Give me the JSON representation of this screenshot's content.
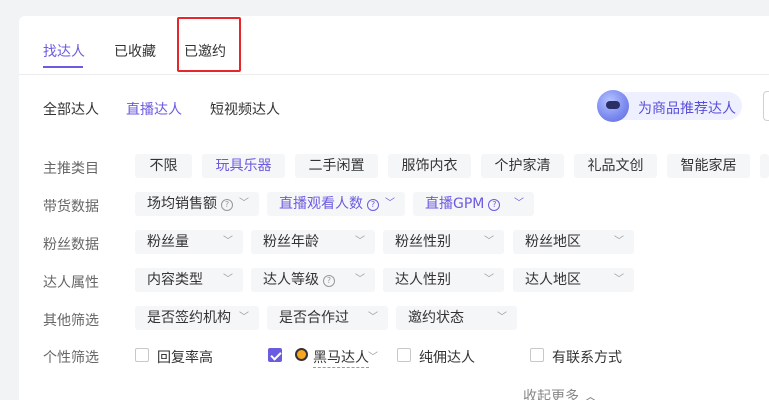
{
  "tabs": [
    {
      "label": "找达人",
      "active": true
    },
    {
      "label": "已收藏",
      "active": false
    },
    {
      "label": "已邀约",
      "active": false
    }
  ],
  "subtabs": [
    {
      "label": "全部达人",
      "active": false
    },
    {
      "label": "直播达人",
      "active": true
    },
    {
      "label": "短视频达人",
      "active": false
    }
  ],
  "recommend_button": {
    "label": "为商品推荐达人",
    "icon": "robot-icon"
  },
  "filters": {
    "category": {
      "label": "主推类目",
      "options": [
        "不限",
        "玩具乐器",
        "二手闲置",
        "服饰内衣",
        "个护家清",
        "礼品文创",
        "智能家居"
      ],
      "selected": "玩具乐器"
    },
    "sales_data": {
      "label": "带货数据",
      "items": [
        "场均销售额",
        "直播观看人数",
        "直播GPM"
      ]
    },
    "fan_data": {
      "label": "粉丝数据",
      "items": [
        "粉丝量",
        "粉丝年龄",
        "粉丝性别",
        "粉丝地区"
      ]
    },
    "creator_attr": {
      "label": "达人属性",
      "items": [
        "内容类型",
        "达人等级",
        "达人性别",
        "达人地区"
      ]
    },
    "other": {
      "label": "其他筛选",
      "items": [
        "是否签约机构",
        "是否合作过",
        "邀约状态"
      ]
    },
    "personal": {
      "label": "个性筛选",
      "checkboxes": [
        {
          "label": "回复率高",
          "checked": false
        },
        {
          "label": "黑马达人",
          "checked": true
        },
        {
          "label": "纯佣达人",
          "checked": false
        },
        {
          "label": "有联系方式",
          "checked": false
        }
      ]
    }
  },
  "collapse_label": "收起更多 ︿",
  "colors": {
    "accent": "#6b5be0",
    "highlight": "#e5262b"
  }
}
